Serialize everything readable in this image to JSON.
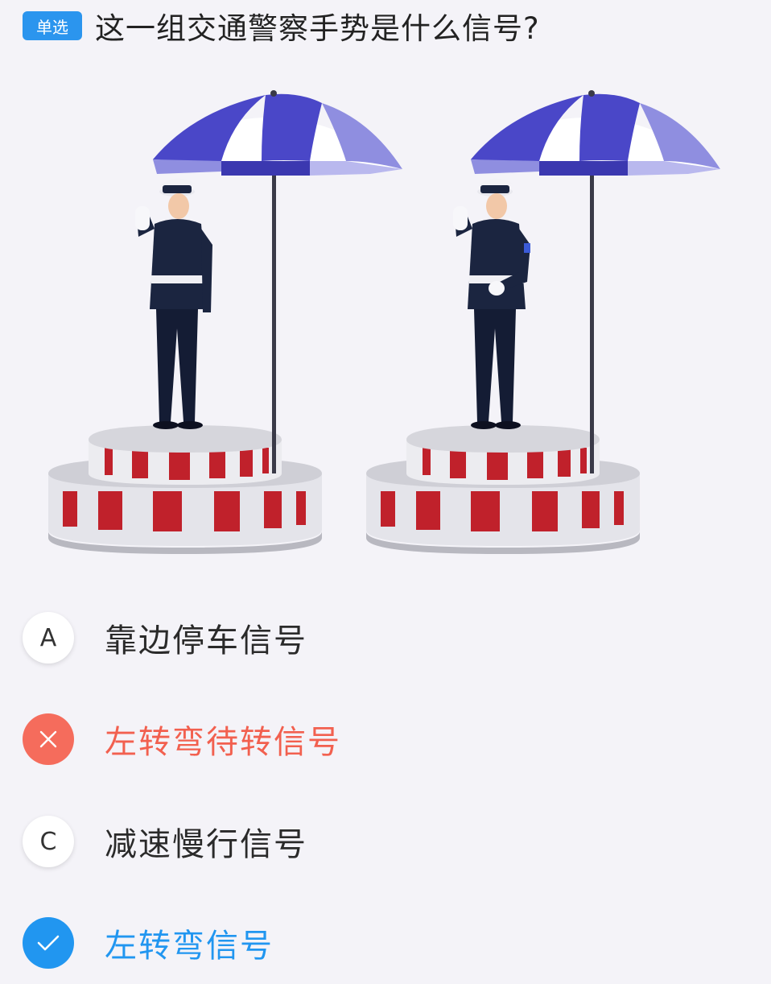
{
  "question": {
    "type_badge": "单选",
    "text": "这一组交通警察手势是什么信号?"
  },
  "illustration": {
    "umbrella_colors": [
      "#4a47c8",
      "#ffffff",
      "#8f8ee0"
    ],
    "platform_colors": [
      "#c0212b",
      "#e6e6ea"
    ],
    "uniform_color": "#1b2540"
  },
  "options": [
    {
      "marker": "A",
      "label": "靠边停车信号",
      "state": "normal",
      "marker_icon": ""
    },
    {
      "marker": "",
      "label": "左转弯待转信号",
      "state": "wrong",
      "marker_icon": "cross-icon"
    },
    {
      "marker": "C",
      "label": "减速慢行信号",
      "state": "normal",
      "marker_icon": ""
    },
    {
      "marker": "",
      "label": "左转弯信号",
      "state": "correct",
      "marker_icon": "check-icon"
    }
  ],
  "colors": {
    "accent": "#2196f0",
    "wrong": "#f56c5c",
    "background": "#f4f3f8"
  }
}
